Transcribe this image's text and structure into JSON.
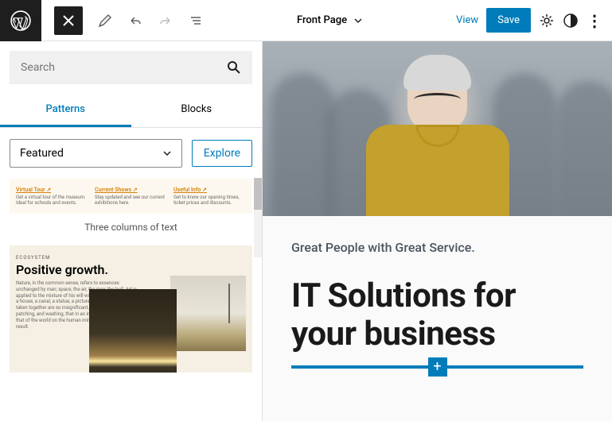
{
  "topbar": {
    "page_title": "Front Page",
    "view_label": "View",
    "save_label": "Save"
  },
  "sidebar": {
    "search_placeholder": "Search",
    "tabs": {
      "patterns": "Patterns",
      "blocks": "Blocks"
    },
    "filter_selected": "Featured",
    "explore_label": "Explore",
    "pattern1": {
      "cols": [
        {
          "heading": "Virtual Tour ↗",
          "body": "Get a virtual tour of the museum. Ideal for schools and events."
        },
        {
          "heading": "Current Shows ↗",
          "body": "Stay updated and see our current exhibitions here."
        },
        {
          "heading": "Useful Info ↗",
          "body": "Get to know our opening times, ticket prices and discounts."
        }
      ],
      "label": "Three columns of text"
    },
    "pattern2": {
      "eyebrow": "ECOSYSTEM",
      "heading": "Positive growth.",
      "body": "Nature, in the common sense, refers to essences unchanged by man; space, the air, the river, the leaf. Art is applied to the mixture of his will with the same things, as in a house, a canal, a statue, a picture. But his operations taken together are so insignificant, a little chipping, baking, patching, and washing, that in an impression so grand as that of the world on the human mind, they do not vary the result."
    }
  },
  "canvas": {
    "subtitle": "Great People with Great Service.",
    "headline": "IT Solutions for your business"
  }
}
